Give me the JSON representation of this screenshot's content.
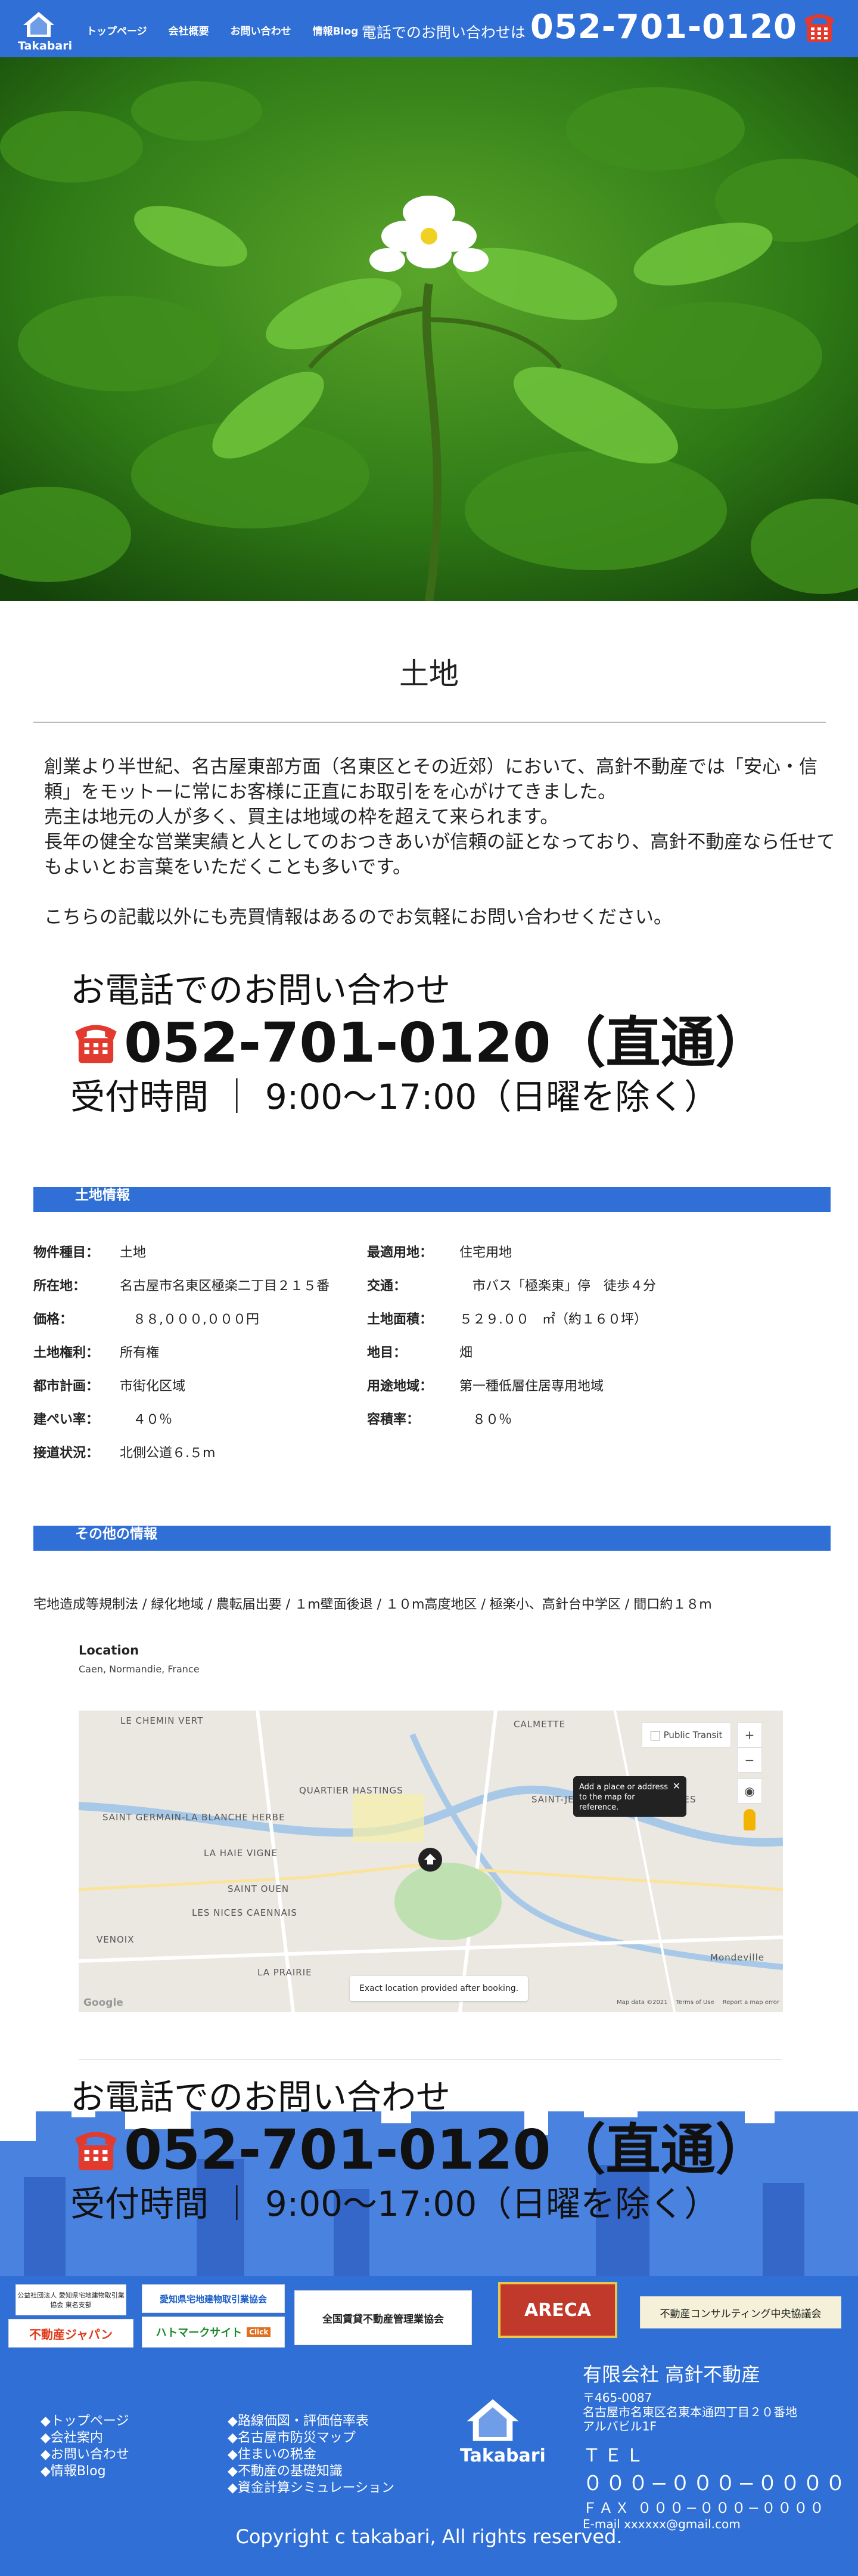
{
  "header": {
    "logo_text": "Takabari",
    "nav": [
      "トップページ",
      "会社概要",
      "お問い合わせ",
      "情報Blog"
    ],
    "phone_label": "電話でのお問い合わせは",
    "phone_number": "052-701-0120",
    "brand_color": "#2f6fd6"
  },
  "page": {
    "title": "土地",
    "intro": [
      "創業より半世紀、名古屋東部方面（名東区とその近郊）において、高針不動産では「安心・信頼」をモットーに常にお客様に正直にお取引をを心がけてきました。",
      "売主は地元の人が多く、買主は地域の枠を超えて来られます。",
      "長年の健全な営業実績と人としてのおつきあいが信頼の証となっており、高針不動産なら任せてもよいとお言葉をいただくことも多いです。",
      "",
      "こちらの記載以外にも売買情報はあるのでお気軽にお問い合わせください。"
    ]
  },
  "call": {
    "heading": "お電話でのお問い合わせ",
    "number": "052-701-0120（直通）",
    "hours": "受付時間 ｜ 9:00〜17:00（日曜を除く）"
  },
  "land_info": {
    "section_title": "土地情報",
    "rows": [
      [
        {
          "k": "物件種目：",
          "v": "土地"
        },
        {
          "k": "最適用地：",
          "v": "住宅用地"
        }
      ],
      [
        {
          "k": "所在地：",
          "v": "名古屋市名東区極楽二丁目２１５番"
        },
        {
          "k": "交通：",
          "v": "　市バス「極楽東」停　徒歩４分"
        }
      ],
      [
        {
          "k": "価格：",
          "v": "　８８,０００,０００円"
        },
        {
          "k": "土地面積：",
          "v": "５２９.００　㎡（約１６０坪）"
        }
      ],
      [
        {
          "k": "土地権利：",
          "v": "所有権"
        },
        {
          "k": "地目：",
          "v": "畑"
        }
      ],
      [
        {
          "k": "都市計画：",
          "v": "市街化区域"
        },
        {
          "k": "用途地域：",
          "v": "第一種低層住居専用地域"
        }
      ],
      [
        {
          "k": "建ぺい率：",
          "v": "　４０％"
        },
        {
          "k": "容積率：",
          "v": "　８０％"
        }
      ],
      [
        {
          "k": "接道状況：",
          "v": "北側公道６.５m"
        },
        {
          "k": "",
          "v": ""
        }
      ]
    ]
  },
  "other_info": {
    "section_title": "その他の情報",
    "text": "宅地造成等規制法 / 緑化地域 / 農転届出要 / １m壁面後退 / １０m高度地区 / 極楽小、高針台中学区 / 間口約１８m"
  },
  "location": {
    "title": "Location",
    "subtitle": "Caen, Normandie, France",
    "map_labels": [
      "LE CHEMIN VERT",
      "CALMETTE",
      "SAINT-JEAN-EUDES SAINT-GILLES",
      "QUARTIER HASTINGS",
      "SAINT GERMAIN-LA BLANCHE HERBE",
      "LA HAIE VIGNE",
      "SAINT OUEN",
      "LES NICES CAENNAIS",
      "VENOIX",
      "LA PRAIRIE",
      "Mondeville"
    ],
    "transit_label": "Public Transit",
    "tooltip": "Add a place or address to the map for reference.",
    "exact_note": "Exact location provided after booking.",
    "map_footer": [
      "Map data ©2021",
      "Terms of Use",
      "Report a map error"
    ],
    "google": "Google"
  },
  "footer": {
    "banners": [
      "公益社団法人 愛知県宅地建物取引業協会 東名支部",
      "不動産ジャパン",
      "愛知県宅地建物取引業協会",
      "ハトマークサイト",
      "全国賃貸不動産管理業協会",
      "ARECA",
      "不動産コンサルティング中央協議会"
    ],
    "banner_click": "Click",
    "company": "有限会社 高針不動産",
    "zip": "〒465-0087",
    "address1": "名古屋市名東区名東本通四丁目２０番地",
    "address2": "アルバビル1F",
    "tel_label": "ＴＥＬ",
    "tel": "０００−０００−００００",
    "fax": "ＦＡＸ ０００−０００−００００",
    "email": "E-mail xxxxxx@gmail.com",
    "links_left": [
      "◆トップページ",
      "◆会社案内",
      "◆お問い合わせ",
      "◆情報Blog"
    ],
    "links_mid": [
      "◆路線価図・評価倍率表",
      "◆名古屋市防災マップ",
      "◆住まいの税金",
      "◆不動産の基礎知識",
      "◆資金計算シミュレーション"
    ],
    "logo_text": "Takabari",
    "copyright": "Copyright c takabari, All rights reserved."
  }
}
